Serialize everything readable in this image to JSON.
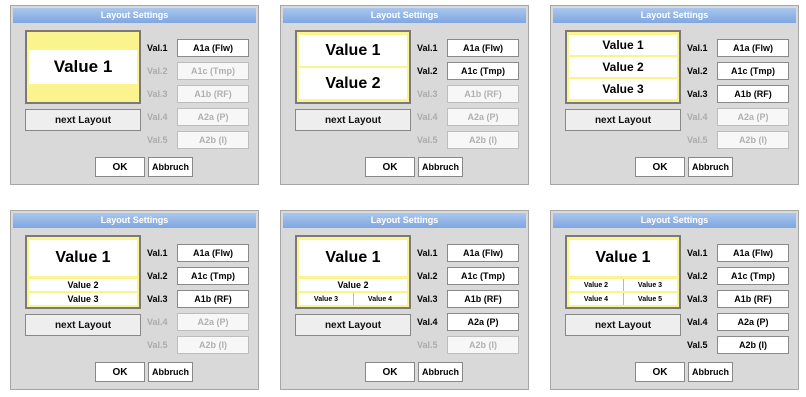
{
  "panels": [
    {
      "title": "Layout Settings",
      "layout": {
        "main": [
          "Value 1"
        ],
        "small_rows": [],
        "quad": []
      },
      "values": [
        {
          "label": "Val.1",
          "field": "A1a (Flw)",
          "active": true
        },
        {
          "label": "Val.2",
          "field": "A1c (Tmp)",
          "active": false
        },
        {
          "label": "Val.3",
          "field": "A1b (RF)",
          "active": false
        },
        {
          "label": "Val.4",
          "field": "A2a (P)",
          "active": false
        },
        {
          "label": "Val.5",
          "field": "A2b (I)",
          "active": false
        }
      ],
      "next_layout": "next Layout",
      "ok": "OK",
      "cancel": "Abbruch"
    },
    {
      "title": "Layout Settings",
      "layout": {
        "main": [
          "Value 1",
          "Value 2"
        ],
        "small_rows": [],
        "quad": []
      },
      "values": [
        {
          "label": "Val.1",
          "field": "A1a (Flw)",
          "active": true
        },
        {
          "label": "Val.2",
          "field": "A1c (Tmp)",
          "active": true
        },
        {
          "label": "Val.3",
          "field": "A1b (RF)",
          "active": false
        },
        {
          "label": "Val.4",
          "field": "A2a (P)",
          "active": false
        },
        {
          "label": "Val.5",
          "field": "A2b (I)",
          "active": false
        }
      ],
      "next_layout": "next Layout",
      "ok": "OK",
      "cancel": "Abbruch"
    },
    {
      "title": "Layout Settings",
      "layout": {
        "main": [
          "Value 1",
          "Value 2",
          "Value 3"
        ],
        "small_rows": [],
        "quad": []
      },
      "values": [
        {
          "label": "Val.1",
          "field": "A1a (Flw)",
          "active": true
        },
        {
          "label": "Val.2",
          "field": "A1c (Tmp)",
          "active": true
        },
        {
          "label": "Val.3",
          "field": "A1b (RF)",
          "active": true
        },
        {
          "label": "Val.4",
          "field": "A2a (P)",
          "active": false
        },
        {
          "label": "Val.5",
          "field": "A2b (I)",
          "active": false
        }
      ],
      "next_layout": "next Layout",
      "ok": "OK",
      "cancel": "Abbruch"
    },
    {
      "title": "Layout Settings",
      "layout": {
        "main": [
          "Value 1"
        ],
        "small_rows": [
          "Value 2",
          "Value 3"
        ],
        "quad": []
      },
      "values": [
        {
          "label": "Val.1",
          "field": "A1a (Flw)",
          "active": true
        },
        {
          "label": "Val.2",
          "field": "A1c (Tmp)",
          "active": true
        },
        {
          "label": "Val.3",
          "field": "A1b (RF)",
          "active": true
        },
        {
          "label": "Val.4",
          "field": "A2a (P)",
          "active": false
        },
        {
          "label": "Val.5",
          "field": "A2b (I)",
          "active": false
        }
      ],
      "next_layout": "next Layout",
      "ok": "OK",
      "cancel": "Abbruch"
    },
    {
      "title": "Layout Settings",
      "layout": {
        "main": [
          "Value 1"
        ],
        "small_rows": [
          "Value 2"
        ],
        "quad": [
          [
            "Value 3",
            "Value 4"
          ]
        ]
      },
      "values": [
        {
          "label": "Val.1",
          "field": "A1a (Flw)",
          "active": true
        },
        {
          "label": "Val.2",
          "field": "A1c (Tmp)",
          "active": true
        },
        {
          "label": "Val.3",
          "field": "A1b (RF)",
          "active": true
        },
        {
          "label": "Val.4",
          "field": "A2a (P)",
          "active": true
        },
        {
          "label": "Val.5",
          "field": "A2b (I)",
          "active": false
        }
      ],
      "next_layout": "next Layout",
      "ok": "OK",
      "cancel": "Abbruch"
    },
    {
      "title": "Layout Settings",
      "layout": {
        "main": [
          "Value 1"
        ],
        "small_rows": [],
        "quad": [
          [
            "Value 2",
            "Value 3"
          ],
          [
            "Value 4",
            "Value 5"
          ]
        ]
      },
      "values": [
        {
          "label": "Val.1",
          "field": "A1a (Flw)",
          "active": true
        },
        {
          "label": "Val.2",
          "field": "A1c (Tmp)",
          "active": true
        },
        {
          "label": "Val.3",
          "field": "A1b (RF)",
          "active": true
        },
        {
          "label": "Val.4",
          "field": "A2a (P)",
          "active": true
        },
        {
          "label": "Val.5",
          "field": "A2b (I)",
          "active": true
        }
      ],
      "next_layout": "next Layout",
      "ok": "OK",
      "cancel": "Abbruch"
    }
  ]
}
